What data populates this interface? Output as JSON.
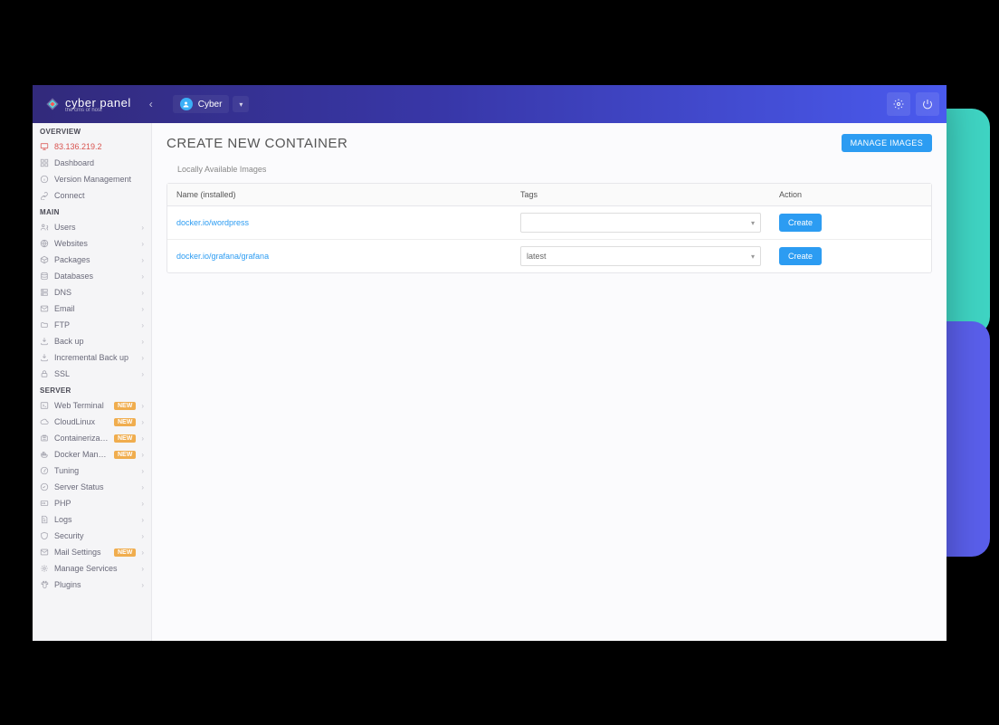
{
  "brand": {
    "name": "cyber panel",
    "tagline": "the cms of host"
  },
  "user": {
    "name": "Cyber"
  },
  "page": {
    "title": "CREATE NEW CONTAINER",
    "manage_button": "MANAGE IMAGES",
    "panel_title": "Locally Available Images"
  },
  "table": {
    "headers": {
      "name": "Name (installed)",
      "tags": "Tags",
      "action": "Action"
    },
    "rows": [
      {
        "name": "docker.io/wordpress",
        "tag": "",
        "action": "Create"
      },
      {
        "name": "docker.io/grafana/grafana",
        "tag": "latest",
        "action": "Create"
      }
    ]
  },
  "sidebar": {
    "groups": [
      {
        "title": "OVERVIEW",
        "items": [
          {
            "label": "83.136.219.2",
            "icon": "desktop",
            "red": true
          },
          {
            "label": "Dashboard",
            "icon": "dashboard"
          },
          {
            "label": "Version Management",
            "icon": "info"
          },
          {
            "label": "Connect",
            "icon": "link"
          }
        ]
      },
      {
        "title": "MAIN",
        "items": [
          {
            "label": "Users",
            "icon": "users",
            "chevron": true
          },
          {
            "label": "Websites",
            "icon": "globe",
            "chevron": true
          },
          {
            "label": "Packages",
            "icon": "package",
            "chevron": true
          },
          {
            "label": "Databases",
            "icon": "database",
            "chevron": true
          },
          {
            "label": "DNS",
            "icon": "dns",
            "chevron": true
          },
          {
            "label": "Email",
            "icon": "email",
            "chevron": true
          },
          {
            "label": "FTP",
            "icon": "ftp",
            "chevron": true
          },
          {
            "label": "Back up",
            "icon": "backup",
            "chevron": true
          },
          {
            "label": "Incremental Back up",
            "icon": "backup",
            "chevron": true
          },
          {
            "label": "SSL",
            "icon": "lock",
            "chevron": true
          }
        ]
      },
      {
        "title": "SERVER",
        "items": [
          {
            "label": "Web Terminal",
            "icon": "terminal",
            "badge": "NEW",
            "chevron": true
          },
          {
            "label": "CloudLinux",
            "icon": "cloud",
            "badge": "NEW",
            "chevron": true
          },
          {
            "label": "Containerization",
            "icon": "container",
            "badge": "NEW",
            "chevron": true
          },
          {
            "label": "Docker Manager",
            "icon": "docker",
            "badge": "NEW",
            "chevron": true
          },
          {
            "label": "Tuning",
            "icon": "tuning",
            "chevron": true
          },
          {
            "label": "Server Status",
            "icon": "status",
            "chevron": true
          },
          {
            "label": "PHP",
            "icon": "php",
            "chevron": true
          },
          {
            "label": "Logs",
            "icon": "logs",
            "chevron": true
          },
          {
            "label": "Security",
            "icon": "security",
            "chevron": true
          },
          {
            "label": "Mail Settings",
            "icon": "mail",
            "badge": "NEW",
            "chevron": true
          },
          {
            "label": "Manage Services",
            "icon": "services",
            "chevron": true
          },
          {
            "label": "Plugins",
            "icon": "plugin",
            "chevron": true
          }
        ]
      }
    ]
  }
}
